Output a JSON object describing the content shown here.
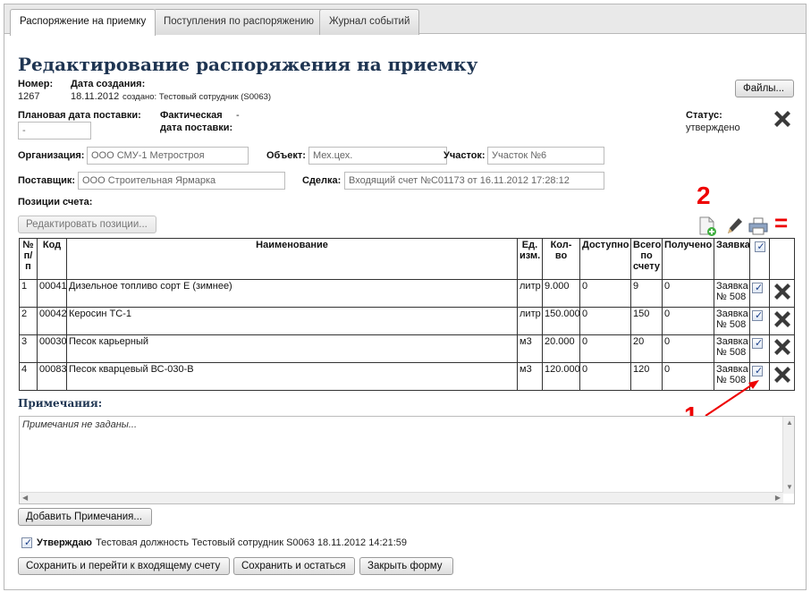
{
  "tabs": [
    {
      "label": "Распоряжение на приемку"
    },
    {
      "label": "Поступления по распоряжению"
    },
    {
      "label": "Журнал событий"
    }
  ],
  "page_title": "Редактирование распоряжения на приемку",
  "number": {
    "label": "Номер:",
    "value": "1267"
  },
  "created": {
    "label": "Дата создания:",
    "date": "18.11.2012",
    "by": "создано: Тестовый сотрудник (S0063)"
  },
  "files_button": "Файлы...",
  "planned_date": {
    "label": "Плановая дата поставки:",
    "value": "-"
  },
  "actual_date": {
    "label_line1": "Фактическая",
    "label_line2": "дата поставки:",
    "value": "-"
  },
  "status": {
    "label": "Статус:",
    "value": "утверждено"
  },
  "organization": {
    "label": "Организация:",
    "value": "ООО СМУ-1 Метростроя"
  },
  "object": {
    "label": "Объект:",
    "value": "Мех.цех."
  },
  "section": {
    "label": "Участок:",
    "value": "Участок №6"
  },
  "supplier": {
    "label": "Поставщик:",
    "value": "ООО Строительная Ярмарка"
  },
  "deal": {
    "label": "Сделка:",
    "value": "Входящий счет №С01173 от 16.11.2012 17:28:12"
  },
  "positions_label": "Позиции счета:",
  "edit_positions_button": "Редактировать позиции...",
  "table": {
    "headers": {
      "num": "№ п/п",
      "code": "Код",
      "name": "Наименование",
      "unit": "Ед. изм.",
      "qty": "Кол-во",
      "available": "Доступно",
      "total": "Всего по счету",
      "received": "Получено",
      "request": "Заявка"
    },
    "rows": [
      {
        "num": "1",
        "code": "00041",
        "name": "Дизельное топливо сорт Е (зимнее)",
        "unit": "литр",
        "qty": "9.000",
        "available": "0",
        "total": "9",
        "received": "0",
        "request": "Заявка № 508",
        "checked": true
      },
      {
        "num": "2",
        "code": "00042",
        "name": "Керосин ТС-1",
        "unit": "литр",
        "qty": "150.000",
        "available": "0",
        "total": "150",
        "received": "0",
        "request": "Заявка № 508",
        "checked": true
      },
      {
        "num": "3",
        "code": "00030",
        "name": "Песок карьерный",
        "unit": "м3",
        "qty": "20.000",
        "available": "0",
        "total": "20",
        "received": "0",
        "request": "Заявка № 508",
        "checked": true
      },
      {
        "num": "4",
        "code": "00083",
        "name": "Песок кварцевый ВС-030-В",
        "unit": "м3",
        "qty": "120.000",
        "available": "0",
        "total": "120",
        "received": "0",
        "request": "Заявка № 508",
        "checked": true
      }
    ]
  },
  "notes": {
    "label": "Примечания:",
    "placeholder": "Примечания не заданы..."
  },
  "add_notes_button": "Добавить Примечания...",
  "approve": {
    "label": "Утверждаю",
    "text": "Тестовая должность Тестовый сотрудник S0063 18.11.2012 14:21:59",
    "checked": true
  },
  "buttons": {
    "save_go": "Сохранить и перейти к входящему счету",
    "save_stay": "Сохранить и остаться",
    "close": "Закрыть форму"
  },
  "annotations": {
    "one": "1",
    "two": "2",
    "equals": "="
  },
  "icons": {
    "status": "close-x-icon",
    "toolbar": [
      "add-document-icon",
      "edit-pencil-icon",
      "print-icon"
    ],
    "row_delete": "close-x-icon",
    "checkbox": "checkmark-icon"
  },
  "colors": {
    "title": "#1f3552",
    "annotation": "#e00000",
    "x_icon": "#3a3a3a"
  }
}
